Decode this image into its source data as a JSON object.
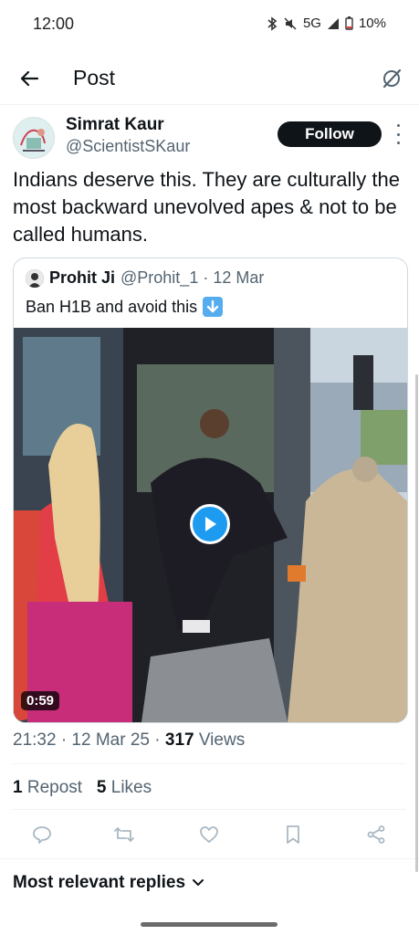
{
  "status": {
    "time": "12:00",
    "network": "5G",
    "battery": "10%"
  },
  "header": {
    "title": "Post"
  },
  "post": {
    "author_name": "Simrat Kaur",
    "author_handle": "@ScientistSKaur",
    "follow_label": "Follow",
    "text": "Indians deserve this. They are culturally the most backward unevolved apes & not to be called humans.",
    "timestamp": "21:32 · 12 Mar 25 · ",
    "views_count": "317",
    "views_label": " Views",
    "reposts_count": "1",
    "reposts_label": " Repost",
    "likes_count": "5",
    "likes_label": " Likes"
  },
  "quote": {
    "author_name": "Prohit Ji",
    "meta": "@Prohit_1 · 12 Mar",
    "text": "Ban H1B and avoid this",
    "video_duration": "0:59"
  },
  "replies": {
    "sort_label": "Most relevant replies"
  },
  "colors": {
    "accent": "#1d9bf0",
    "text": "#0f1419",
    "secondary": "#536471"
  },
  "icons": [
    "back-arrow-icon",
    "grok-icon",
    "more-icon",
    "play-icon",
    "reply-icon",
    "repost-icon",
    "like-icon",
    "bookmark-icon",
    "share-icon",
    "chevron-down-icon",
    "down-arrow-emoji-icon"
  ]
}
